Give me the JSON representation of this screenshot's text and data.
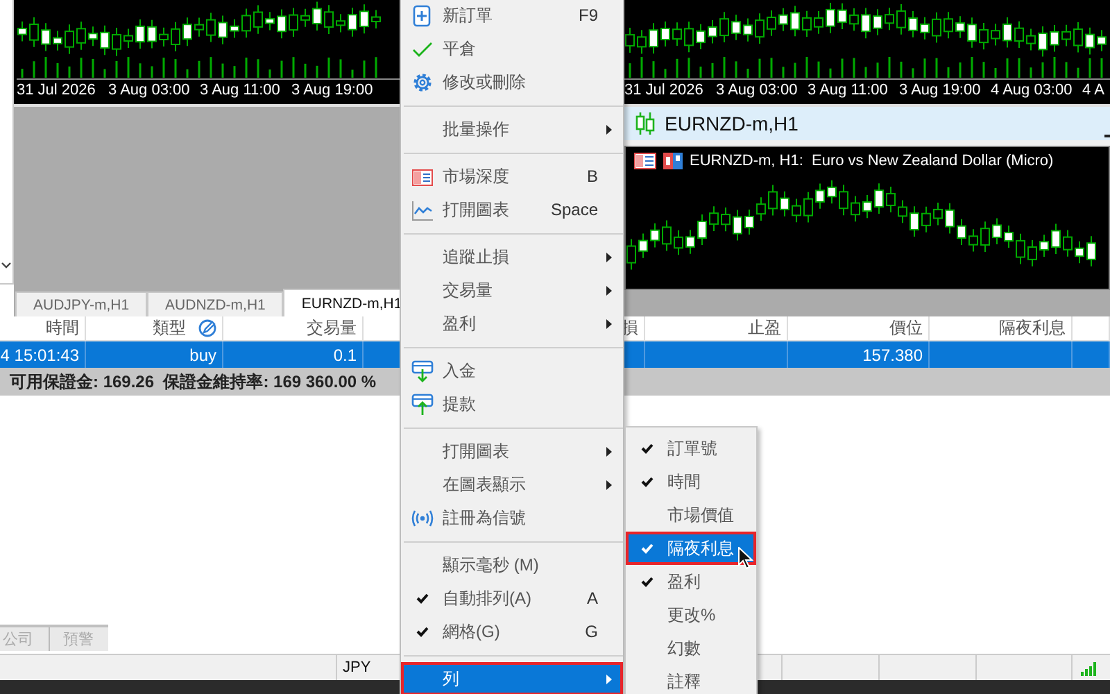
{
  "top_charts": [
    {
      "axis_labels": [
        "31 Jul 2026",
        "3 Aug 03:00",
        "3 Aug 11:00",
        "3 Aug 19:00"
      ]
    },
    {
      "axis_labels": [
        "31 Jul 2026",
        "3 Aug 03:00",
        "3 Aug 11:00",
        "3 Aug 19:00",
        "4 Aug 03:00",
        "4 A"
      ]
    }
  ],
  "chart_window": {
    "title": "EURNZD-m,H1",
    "header": "EURNZD-m, H1:  Euro vs New Zealand Dollar (Micro)"
  },
  "chart_tabs": [
    {
      "label": "AUDJPY-m,H1",
      "selected": false
    },
    {
      "label": "AUDNZD-m,H1",
      "selected": false
    },
    {
      "label": "EURNZD-m,H1",
      "selected": true
    }
  ],
  "table": {
    "columns": [
      {
        "label": "時間"
      },
      {
        "label": "類型",
        "edit_icon": true
      },
      {
        "label": "交易量"
      },
      {
        "blank": true
      },
      {
        "label": "損"
      },
      {
        "label": "止盈"
      },
      {
        "label": "價位"
      },
      {
        "label": "隔夜利息"
      },
      {
        "blank": true
      }
    ],
    "rows": [
      {
        "selected": true,
        "cells": [
          "4 15:01:43",
          "buy",
          "0.1",
          null,
          null,
          null,
          "157.380",
          null,
          null
        ]
      }
    ]
  },
  "summary": "可用保證金: 169.26  保證金維持率: 169 360.00 %",
  "bottom_tabs": [
    {
      "label": "公司"
    },
    {
      "label": "預警"
    }
  ],
  "status_bar": {
    "currency": "JPY"
  },
  "context_menu": {
    "items": [
      {
        "kind": "item",
        "label": "新訂單",
        "shortcut": "F9",
        "submenu": false,
        "checked": false,
        "selected": false
      },
      {
        "kind": "item",
        "label": "平倉",
        "submenu": false,
        "checked": false,
        "selected": false
      },
      {
        "kind": "item",
        "label": "修改或刪除",
        "submenu": false,
        "checked": false,
        "selected": false
      },
      {
        "kind": "separator"
      },
      {
        "kind": "item",
        "label": "批量操作",
        "submenu": true,
        "checked": false,
        "selected": false
      },
      {
        "kind": "separator"
      },
      {
        "kind": "item",
        "label": "市場深度",
        "shortcut": "B",
        "submenu": false,
        "checked": false,
        "selected": false
      },
      {
        "kind": "item",
        "label": "打開圖表",
        "shortcut": "Space",
        "submenu": false,
        "checked": false,
        "selected": false
      },
      {
        "kind": "separator"
      },
      {
        "kind": "item",
        "label": "追蹤止損",
        "submenu": true,
        "checked": false,
        "selected": false
      },
      {
        "kind": "item",
        "label": "交易量",
        "submenu": true,
        "checked": false,
        "selected": false
      },
      {
        "kind": "item",
        "label": "盈利",
        "submenu": true,
        "checked": false,
        "selected": false
      },
      {
        "kind": "separator"
      },
      {
        "kind": "item",
        "label": "入金",
        "submenu": false,
        "checked": false,
        "selected": false
      },
      {
        "kind": "item",
        "label": "提款",
        "submenu": false,
        "checked": false,
        "selected": false
      },
      {
        "kind": "separator"
      },
      {
        "kind": "item",
        "label": "打開圖表",
        "submenu": true,
        "checked": false,
        "selected": false
      },
      {
        "kind": "item",
        "label": "在圖表顯示",
        "submenu": true,
        "checked": false,
        "selected": false
      },
      {
        "kind": "item",
        "label": "註冊為信號",
        "submenu": false,
        "checked": false,
        "selected": false
      },
      {
        "kind": "separator"
      },
      {
        "kind": "item",
        "label": "顯示毫秒 (M)",
        "submenu": false,
        "checked": false,
        "selected": false
      },
      {
        "kind": "item",
        "label": "自動排列(A)",
        "shortcut": "A",
        "submenu": false,
        "checked": true,
        "selected": false
      },
      {
        "kind": "item",
        "label": "網格(G)",
        "shortcut": "G",
        "submenu": false,
        "checked": true,
        "selected": false
      },
      {
        "kind": "separator"
      },
      {
        "kind": "item",
        "label": "列",
        "submenu": true,
        "checked": false,
        "selected": true
      }
    ]
  },
  "submenu": {
    "items": [
      {
        "label": "訂單號",
        "checked": true,
        "selected": false
      },
      {
        "label": "時間",
        "checked": true,
        "selected": false
      },
      {
        "label": "市場價值",
        "checked": false,
        "selected": false
      },
      {
        "label": "隔夜利息",
        "checked": true,
        "selected": true
      },
      {
        "label": "盈利",
        "checked": true,
        "selected": false
      },
      {
        "label": "更改%",
        "checked": false,
        "selected": false
      },
      {
        "label": "幻數",
        "checked": false,
        "selected": false
      },
      {
        "label": "註釋",
        "checked": false,
        "selected": false
      }
    ]
  }
}
